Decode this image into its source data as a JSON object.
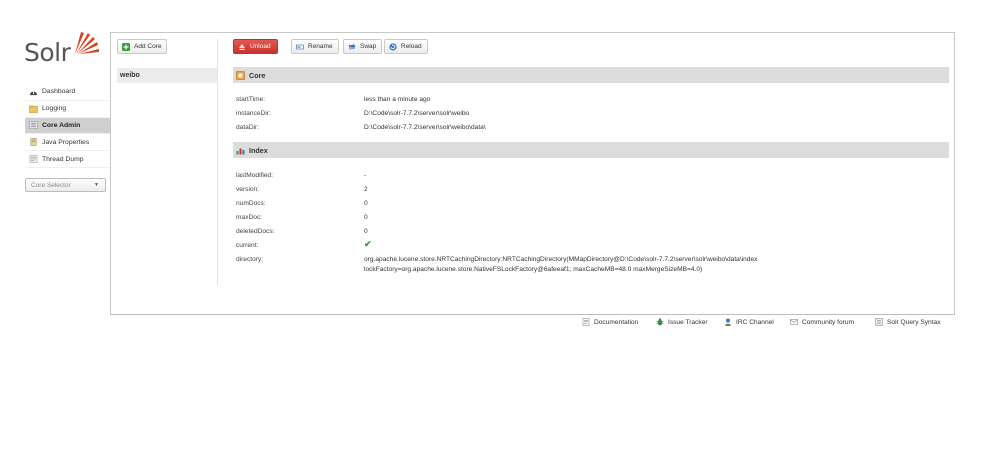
{
  "logo": {
    "text": "Solr"
  },
  "nav": {
    "items": [
      {
        "label": "Dashboard",
        "icon": "dashboard-icon",
        "active": false
      },
      {
        "label": "Logging",
        "icon": "logging-icon",
        "active": false
      },
      {
        "label": "Core Admin",
        "icon": "core-admin-icon",
        "active": true
      },
      {
        "label": "Java Properties",
        "icon": "java-properties-icon",
        "active": false
      },
      {
        "label": "Thread Dump",
        "icon": "thread-dump-icon",
        "active": false
      }
    ],
    "core_selector": {
      "label": "Core Selector"
    }
  },
  "toolbar": {
    "add_core": "Add Core",
    "unload": "Unload",
    "rename": "Rename",
    "swap": "Swap",
    "reload": "Reload"
  },
  "cores": [
    "weibo"
  ],
  "core_section": {
    "title": "Core",
    "rows": [
      {
        "key": "startTime:",
        "value": "less than a minute ago"
      },
      {
        "key": "instanceDir:",
        "value": "D:\\Code\\solr-7.7.2\\server\\solr\\weibo"
      },
      {
        "key": "dataDir:",
        "value": "D:\\Code\\solr-7.7.2\\server\\solr\\weibo\\data\\"
      }
    ]
  },
  "index_section": {
    "title": "Index",
    "rows": [
      {
        "key": "lastModified:",
        "value": "-"
      },
      {
        "key": "version:",
        "value": "2"
      },
      {
        "key": "numDocs:",
        "value": "0"
      },
      {
        "key": "maxDoc:",
        "value": "0"
      },
      {
        "key": "deletedDocs:",
        "value": "0"
      },
      {
        "key": "current:",
        "value": "✔"
      },
      {
        "key": "directory:",
        "value": "org.apache.lucene.store.NRTCachingDirectory:NRTCachingDirectory(MMapDirectory@D:\\Code\\solr-7.7.2\\server\\solr\\weibo\\data\\index lockFactory=org.apache.lucene.store.NativeFSLockFactory@6afeeaf1; maxCacheMB=48.0 maxMergeSizeMB=4.0)"
      }
    ]
  },
  "footer": {
    "links": [
      {
        "label": "Documentation",
        "icon": "documentation-icon"
      },
      {
        "label": "Issue Tracker",
        "icon": "issue-tracker-icon"
      },
      {
        "label": "IRC Channel",
        "icon": "irc-channel-icon"
      },
      {
        "label": "Community forum",
        "icon": "community-forum-icon"
      },
      {
        "label": "Solr Query Syntax",
        "icon": "query-syntax-icon"
      }
    ]
  },
  "colors": {
    "unload_button": "#d9433b",
    "active_nav": "#cfcfcf",
    "section_header": "#dcdcdc",
    "check": "#3a9b35",
    "logo_accent": "#d9411e"
  }
}
